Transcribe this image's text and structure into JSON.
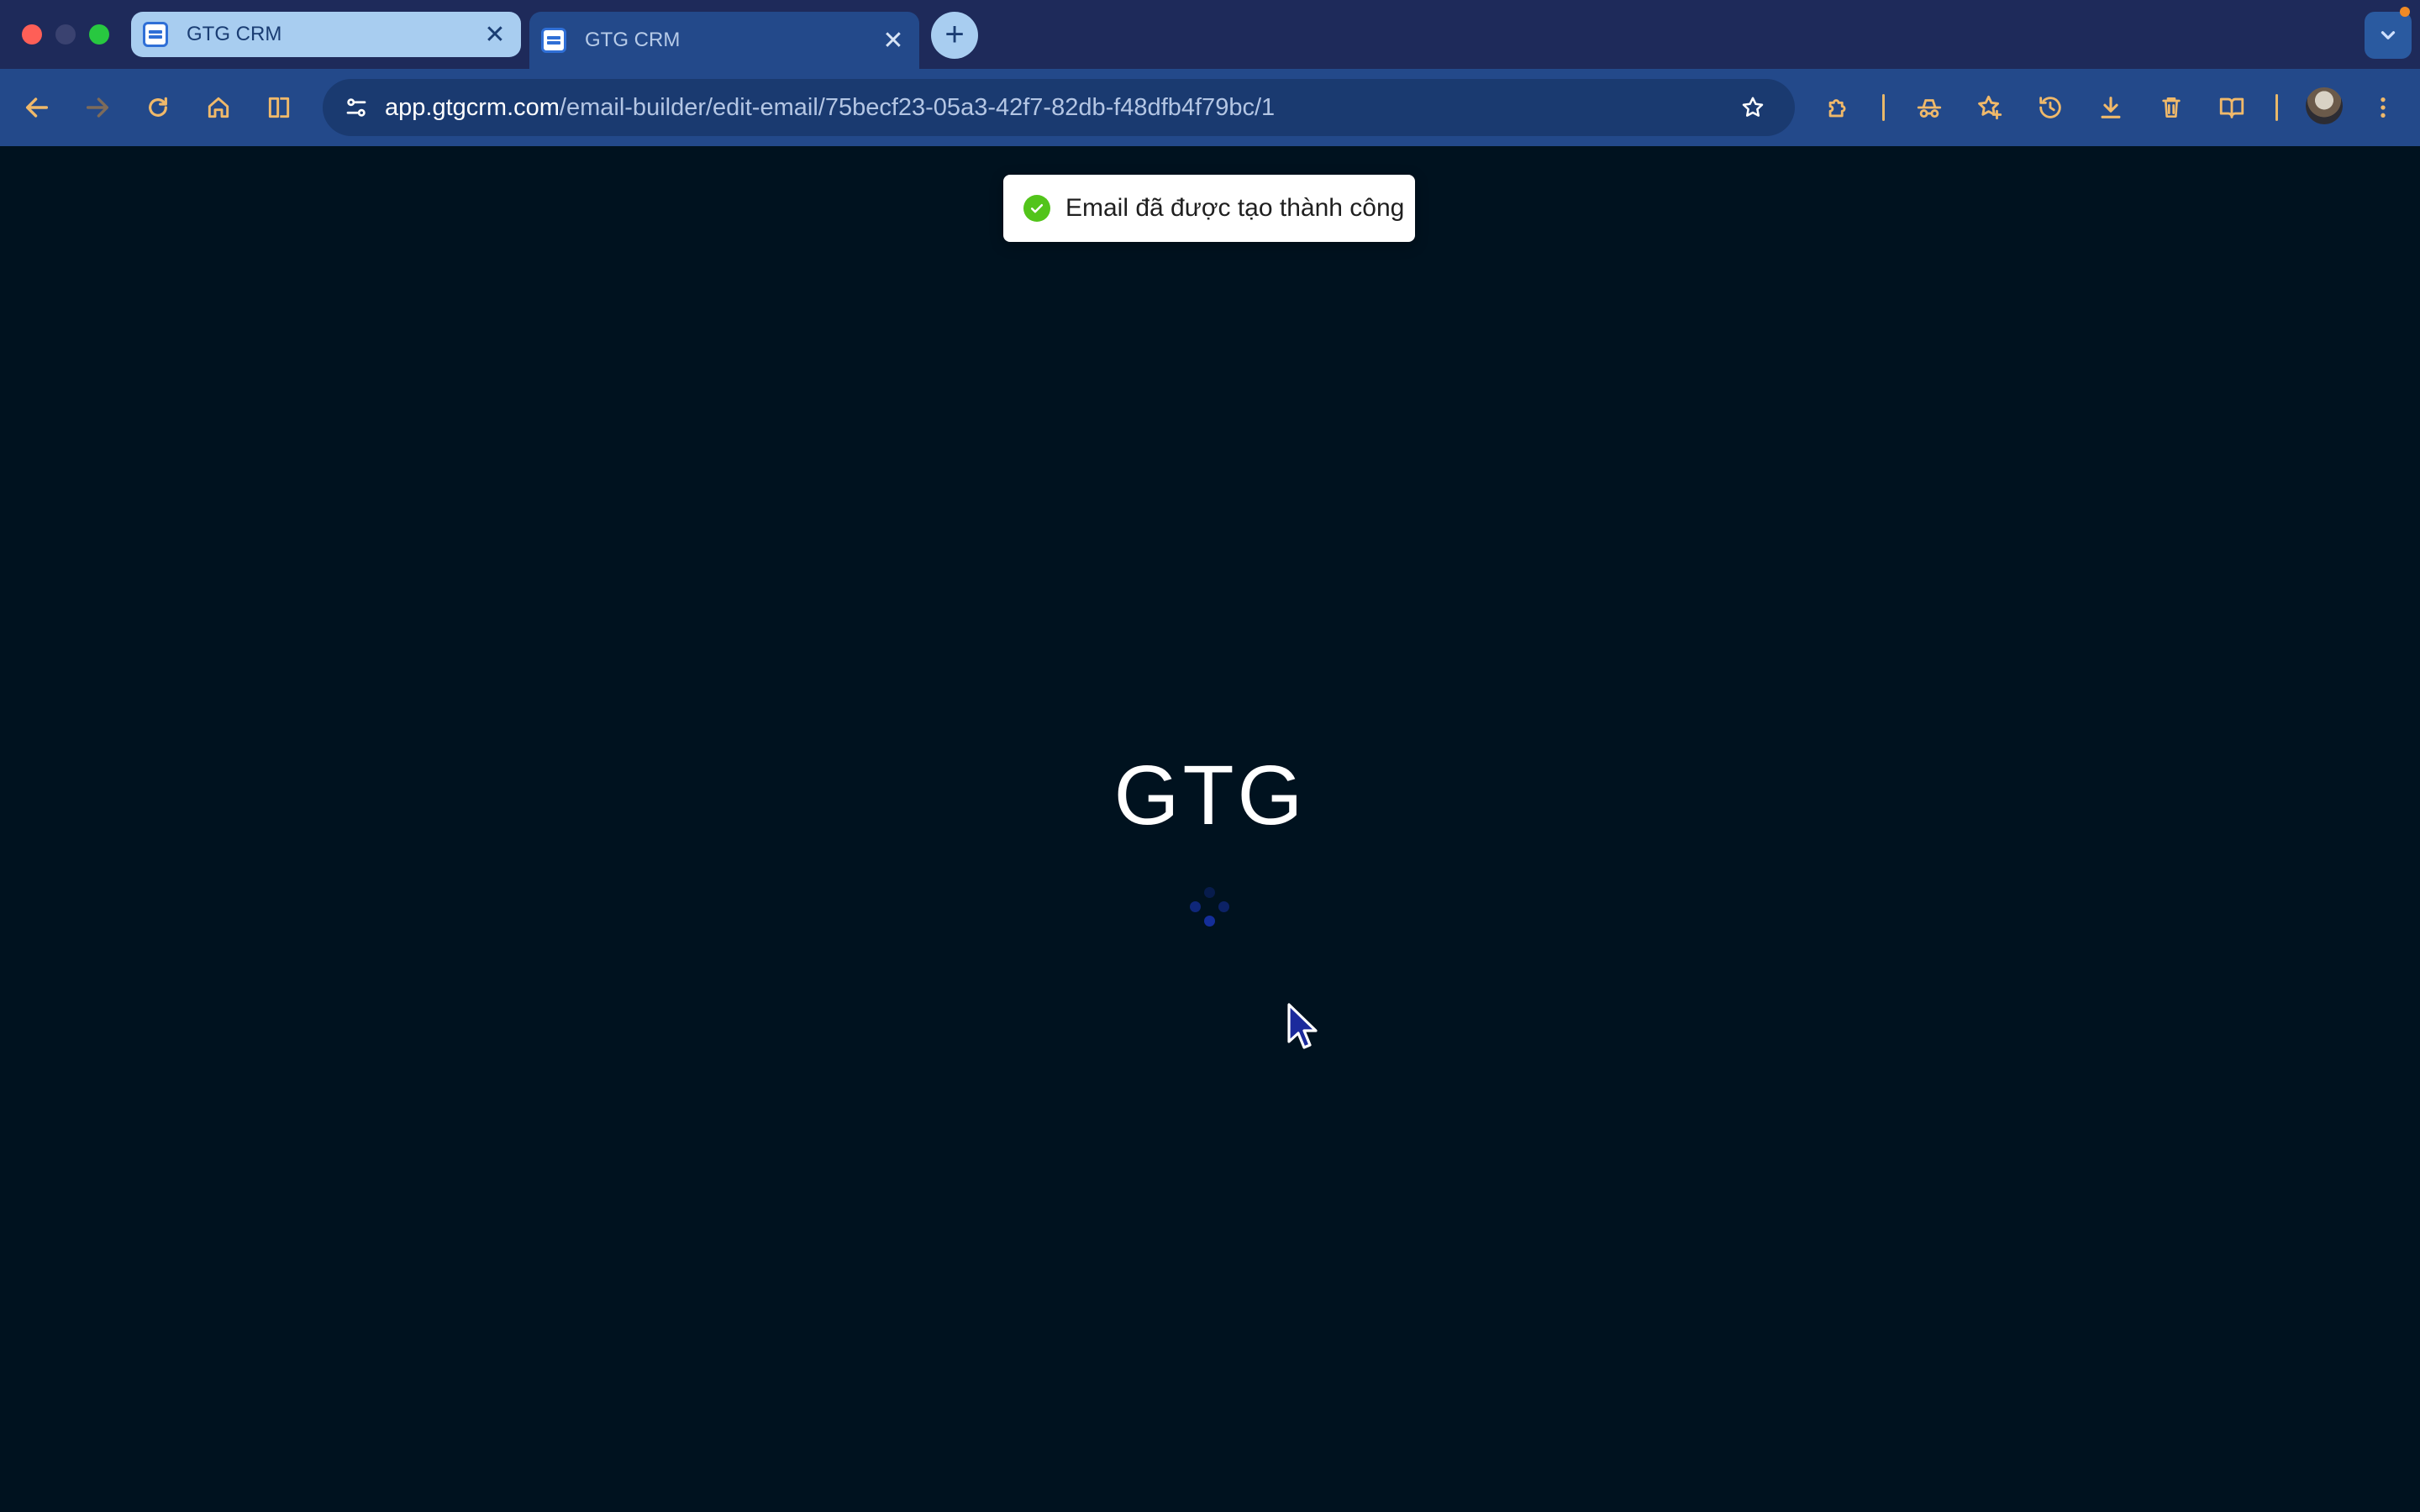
{
  "browser": {
    "tabs": [
      {
        "title": "GTG CRM",
        "active": false
      },
      {
        "title": "GTG CRM",
        "active": true
      }
    ],
    "close_glyph": "✕",
    "new_tab_glyph": "+",
    "url": {
      "host": "app.gtgcrm.com",
      "path": "/email-builder/edit-email/75becf23-05a3-42f7-82db-f48dfb4f79bc/1"
    },
    "toolbar_icons": [
      "back-icon",
      "forward-icon",
      "reload-icon",
      "home-icon",
      "split-view-icon",
      "site-info-icon",
      "bookmark-star-icon",
      "extensions-icon",
      "incognito-icon",
      "favorites-icon",
      "history-icon",
      "download-icon",
      "delete-icon",
      "reading-list-icon",
      "profile-avatar",
      "more-menu-icon"
    ]
  },
  "toast": {
    "message": "Email đã được tạo thành công",
    "status": "success",
    "status_color": "#52c41a"
  },
  "page": {
    "logo_text": "GTG",
    "background_color": "#00121f",
    "spinner_color": "#1530a0"
  }
}
